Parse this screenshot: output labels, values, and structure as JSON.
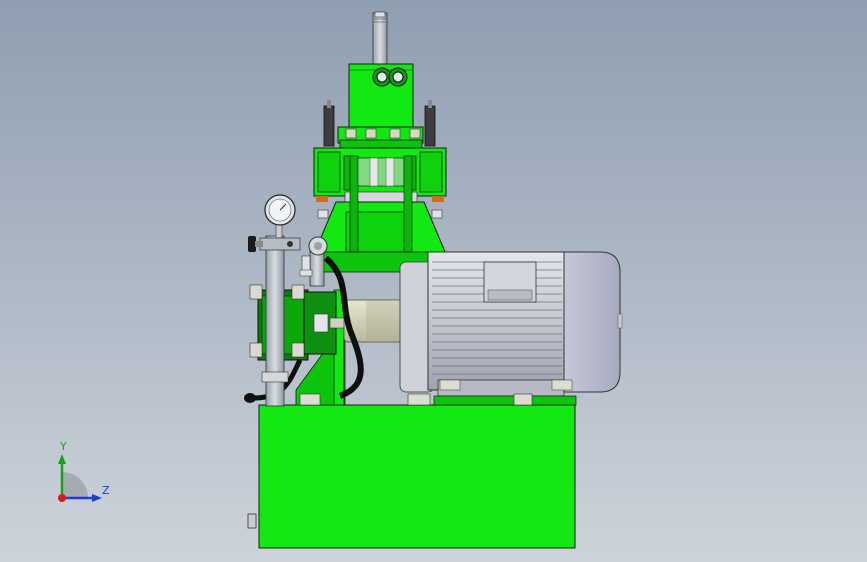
{
  "viewport": {
    "background_top": "#8f9eb1",
    "background_bottom": "#cdd3da"
  },
  "model": {
    "part_green": "#12e812",
    "part_dark_green": "#0aa80a",
    "motor_gray": "#c9ccd4",
    "edge_color": "#1a1a1a"
  },
  "triad": {
    "y_label": "Y",
    "z_label": "Z",
    "y_color": "#17a317",
    "z_color": "#1a3fd6",
    "x_color": "#d81818"
  }
}
